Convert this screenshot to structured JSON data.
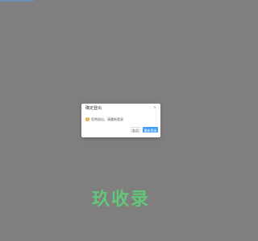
{
  "dialog": {
    "title": "确定登出",
    "close_symbol": "×",
    "message": "您将退出，请重新登录",
    "cancel_label": "取消",
    "confirm_label": "重新登录",
    "warning_symbol": "!"
  },
  "watermark": {
    "text": "玖收录"
  },
  "colors": {
    "overlay": "#7f7f7f",
    "primary": "#409eff",
    "warning": "#e6a23c",
    "watermark": "#62c777"
  }
}
